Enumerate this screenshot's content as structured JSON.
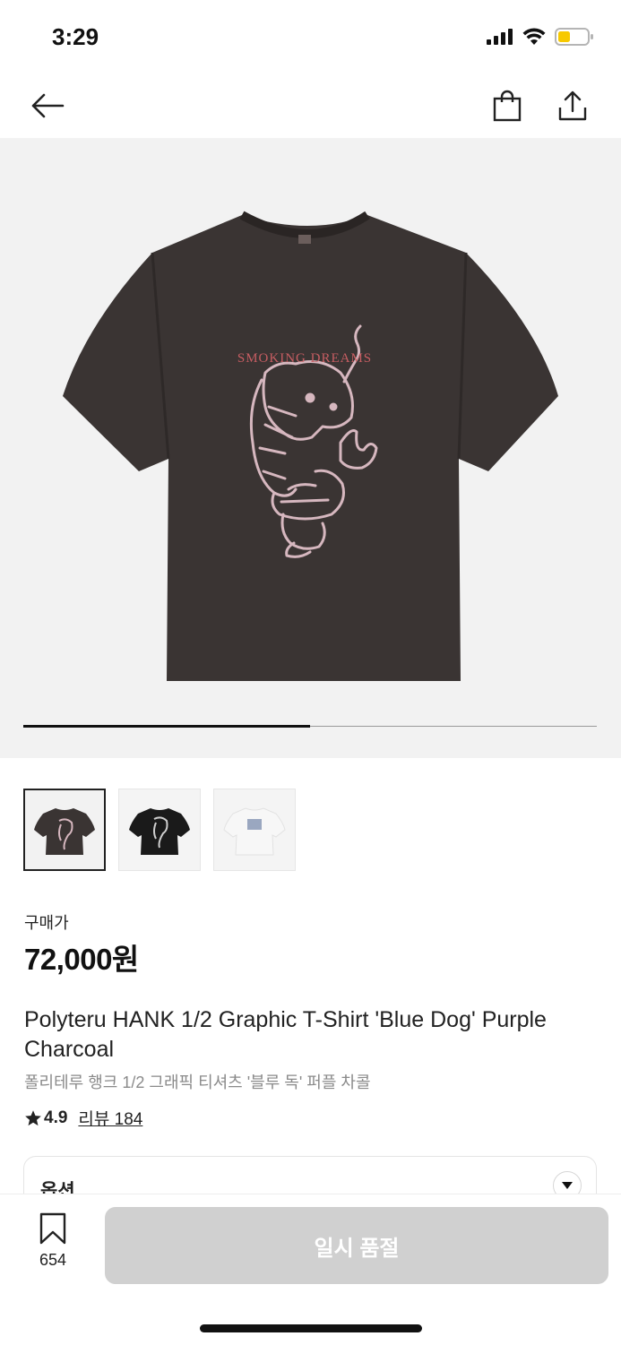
{
  "status_bar": {
    "time": "3:29"
  },
  "gallery": {
    "current_index": 1,
    "total": 2,
    "progress_fraction": 0.5,
    "main_image_text": "SMOKING DREAMS",
    "thumbnails": [
      "purple-charcoal-tee",
      "black-tee",
      "white-tee"
    ]
  },
  "product": {
    "price_label": "구매가",
    "price": "72,000원",
    "title_en": "Polyteru HANK 1/2 Graphic T-Shirt 'Blue Dog' Purple Charcoal",
    "title_ko": "폴리테루 행크 1/2 그래픽 티셔츠 '블루 독' 퍼플 차콜",
    "rating": "4.9",
    "reviews_label": "리뷰 184"
  },
  "options": {
    "label": "옵션"
  },
  "bottom_bar": {
    "bookmark_count": "654",
    "buy_label": "일시 품절"
  },
  "colors": {
    "accent": "#111111",
    "disabled_button": "#d0d0d0",
    "hero_bg": "#f2f2f2",
    "shirt": "#3a3433",
    "print": "#d6b7bf"
  }
}
